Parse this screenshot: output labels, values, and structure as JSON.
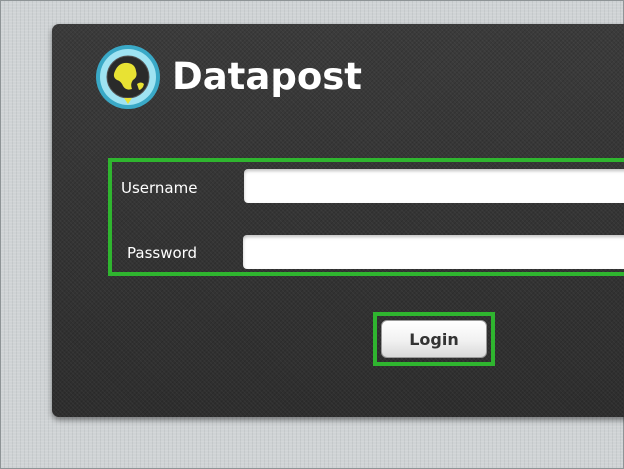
{
  "brand": {
    "name": "Datapost",
    "logo_icon": "globe-icon"
  },
  "form": {
    "username_label": "Username",
    "username_value": "",
    "password_label": "Password",
    "password_value": "",
    "submit_label": "Login"
  },
  "colors": {
    "page_background": "#cfd3d5",
    "panel_background": "#333333",
    "highlight": "#2fb52f",
    "label_text": "#ffffff",
    "input_background": "#ffffff"
  }
}
